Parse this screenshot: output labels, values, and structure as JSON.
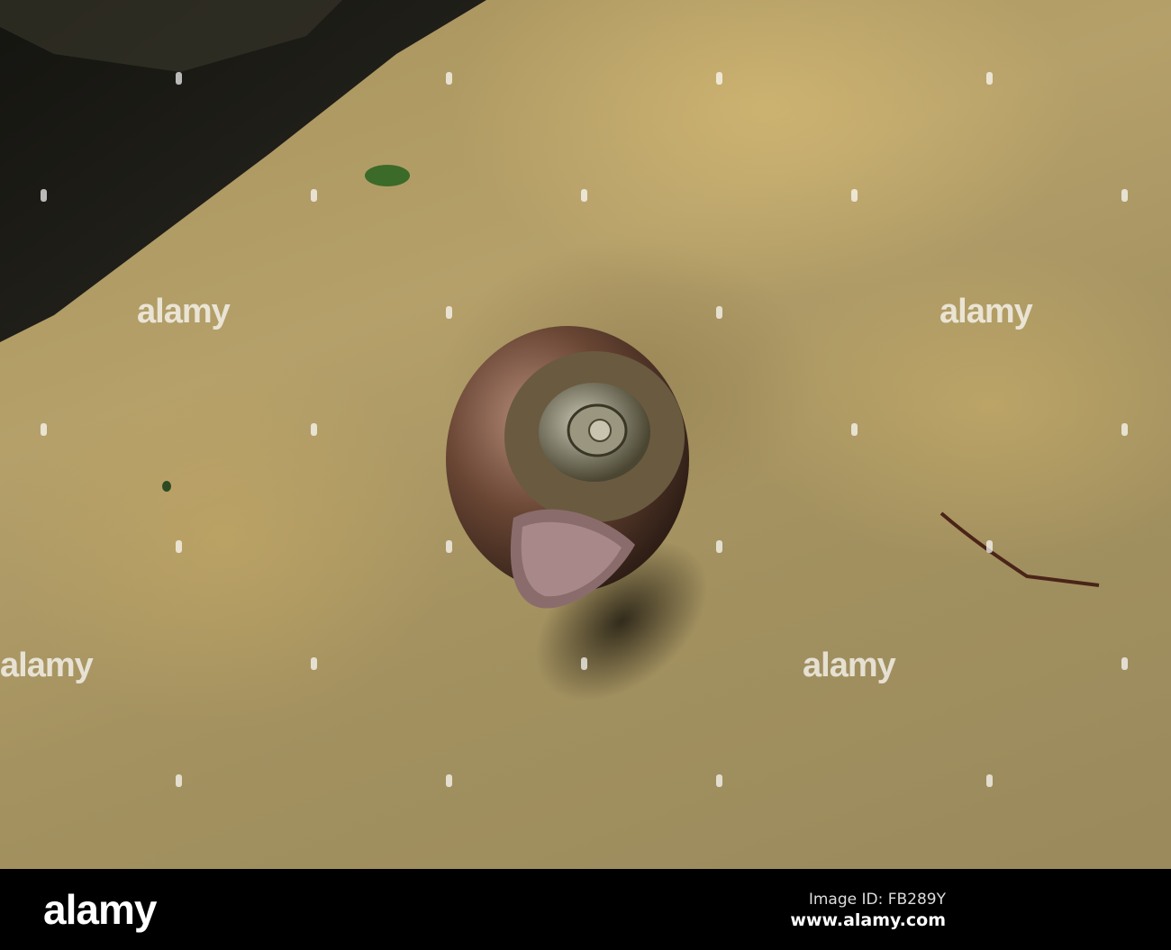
{
  "watermark": {
    "text": "alamy"
  },
  "footer": {
    "logo": "alamy",
    "image_id": "Image ID: FB289Y",
    "website": "www.alamy.com"
  }
}
